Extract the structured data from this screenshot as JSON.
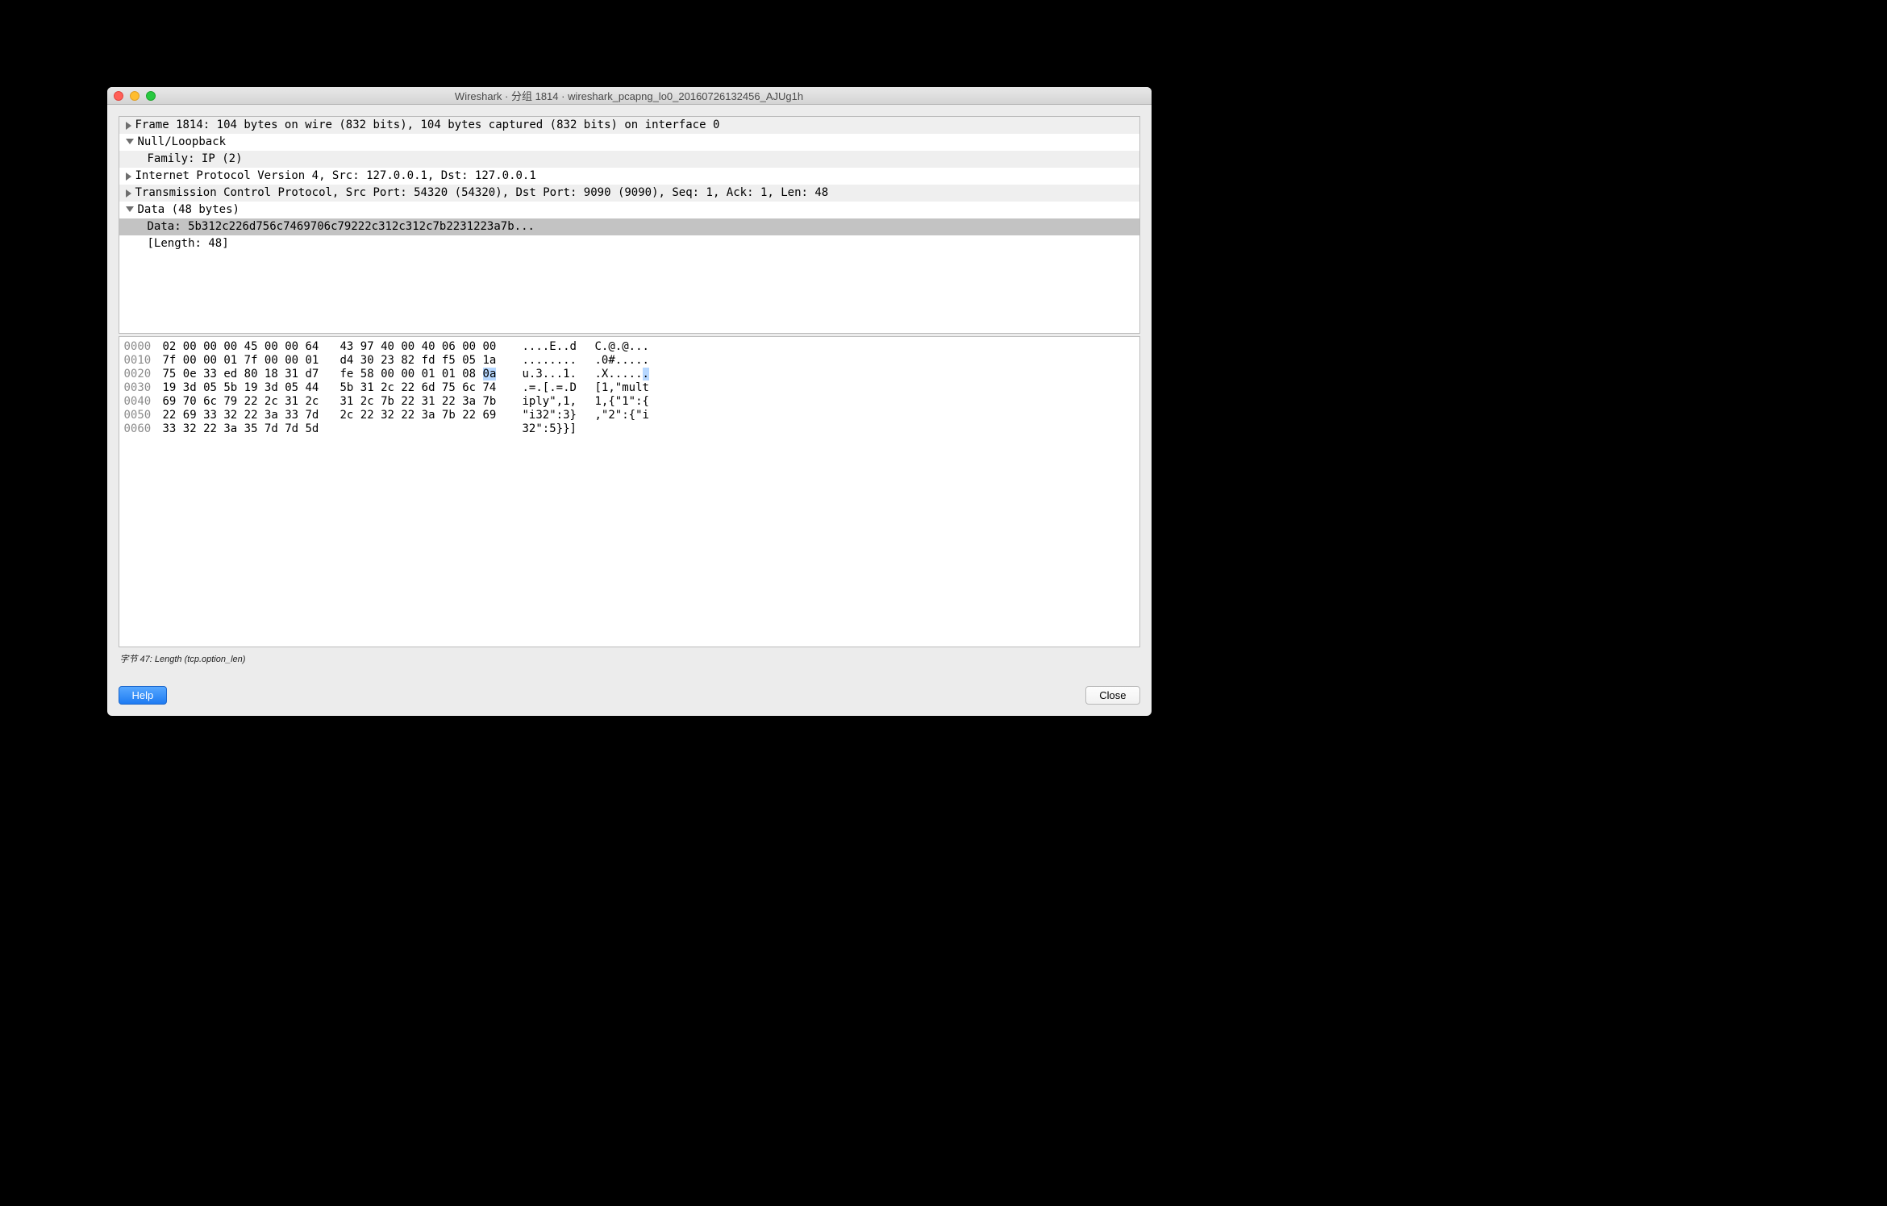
{
  "window": {
    "title": "Wireshark · 分组 1814 · wireshark_pcapng_lo0_20160726132456_AJUg1h"
  },
  "details": {
    "rows": [
      {
        "indent": 0,
        "arrow": "right",
        "alt": true,
        "sel": false,
        "text": "Frame 1814: 104 bytes on wire (832 bits), 104 bytes captured (832 bits) on interface 0"
      },
      {
        "indent": 0,
        "arrow": "down",
        "alt": false,
        "sel": false,
        "text": "Null/Loopback"
      },
      {
        "indent": 1,
        "arrow": "none",
        "alt": true,
        "sel": false,
        "text": "Family: IP (2)"
      },
      {
        "indent": 0,
        "arrow": "right",
        "alt": false,
        "sel": false,
        "text": "Internet Protocol Version 4, Src: 127.0.0.1, Dst: 127.0.0.1"
      },
      {
        "indent": 0,
        "arrow": "right",
        "alt": true,
        "sel": false,
        "text": "Transmission Control Protocol, Src Port: 54320 (54320), Dst Port: 9090 (9090), Seq: 1, Ack: 1, Len: 48"
      },
      {
        "indent": 0,
        "arrow": "down",
        "alt": false,
        "sel": false,
        "text": "Data (48 bytes)"
      },
      {
        "indent": 1,
        "arrow": "none",
        "alt": false,
        "sel": true,
        "text": "Data: 5b312c226d756c7469706c79222c312c312c7b2231223a7b..."
      },
      {
        "indent": 1,
        "arrow": "none",
        "alt": false,
        "sel": false,
        "text": "[Length: 48]"
      }
    ]
  },
  "hex": {
    "lines": [
      {
        "offset": "0000",
        "h1": "02 00 00 00 45 00 00 64",
        "h2": "43 97 40 00 40 06 00 00",
        "a1": "....E..d",
        "a2": "C.@.@..."
      },
      {
        "offset": "0010",
        "h1": "7f 00 00 01 7f 00 00 01",
        "h2": "d4 30 23 82 fd f5 05 1a",
        "a1": "........",
        "a2": ".0#....."
      },
      {
        "offset": "0020",
        "h1": "75 0e 33 ed 80 18 31 d7",
        "h2": "fe 58 00 00 01 01 08 ",
        "a1": "u.3...1.",
        "a2": ".X.....",
        "hl_h2_tail": "0a",
        "hl_a2_tail": "."
      },
      {
        "offset": "0030",
        "h1": "19 3d 05 5b 19 3d 05 44",
        "h2": "5b 31 2c 22 6d 75 6c 74",
        "a1": ".=.[.=.D",
        "a2": "[1,\"mult"
      },
      {
        "offset": "0040",
        "h1": "69 70 6c 79 22 2c 31 2c",
        "h2": "31 2c 7b 22 31 22 3a 7b",
        "a1": "iply\",1,",
        "a2": "1,{\"1\":{"
      },
      {
        "offset": "0050",
        "h1": "22 69 33 32 22 3a 33 7d",
        "h2": "2c 22 32 22 3a 7b 22 69",
        "a1": "\"i32\":3}",
        "a2": ",\"2\":{\"i"
      },
      {
        "offset": "0060",
        "h1": "33 32 22 3a 35 7d 7d 5d",
        "h2": "",
        "a1": "32\":5}}]",
        "a2": ""
      }
    ]
  },
  "status": {
    "text": "字节 47: Length (tcp.option_len)"
  },
  "buttons": {
    "help": "Help",
    "close": "Close"
  }
}
